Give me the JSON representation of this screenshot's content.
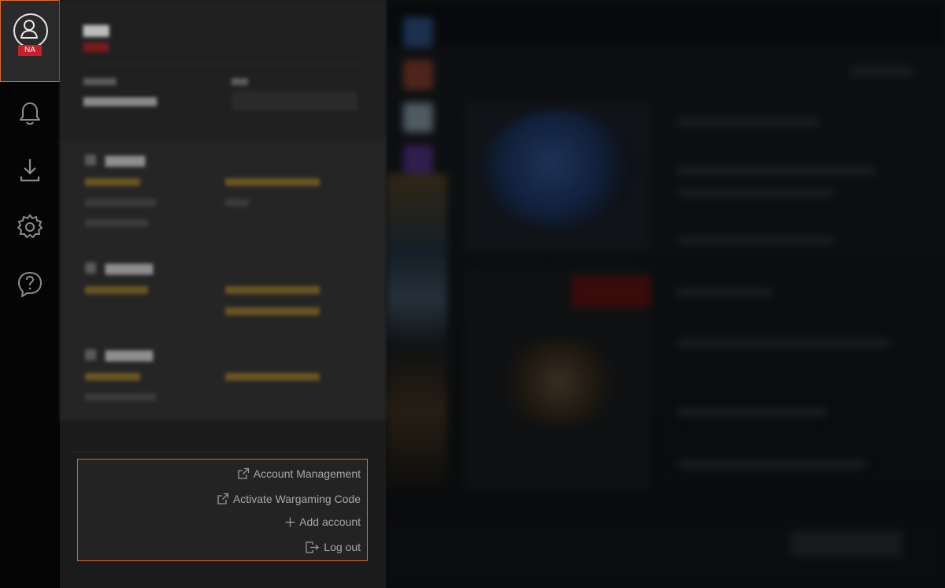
{
  "profile": {
    "region_badge": "NA",
    "icon": "user-icon"
  },
  "rail": {
    "items": [
      {
        "name": "notifications",
        "icon": "bell-icon"
      },
      {
        "name": "downloads",
        "icon": "download-icon"
      },
      {
        "name": "settings",
        "icon": "gear-icon"
      },
      {
        "name": "support",
        "icon": "help-icon"
      }
    ]
  },
  "account_menu": {
    "account_management": "Account Management",
    "activate_code": "Activate Wargaming Code",
    "add_account": "Add account",
    "log_out": "Log out"
  },
  "colors": {
    "accent_outline": "#e0692c",
    "region_badge": "#c8202a",
    "panel": "#1b1b1c",
    "rail": "#050505"
  }
}
